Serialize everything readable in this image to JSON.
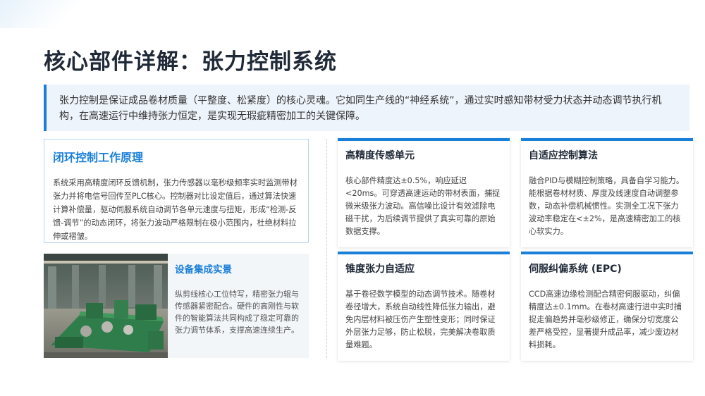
{
  "title": "核心部件详解：张力控制系统",
  "intro": "张力控制是保证成品卷材质量（平整度、松紧度）的核心灵魂。它如同生产线的“神经系统”，通过实时感知带材受力状态并动态调节执行机构，在高速运行中维持张力恒定，是实现无瑕疵精密加工的关键保障。",
  "principle": {
    "heading": "闭环控制工作原理",
    "body": "系统采用高精度闭环反馈机制，张力传感器以毫秒级频率实时监测带材张力并将电信号回传至PLC核心。控制器对比设定值后，通过算法快速计算补偿量，驱动伺服系统自动调节各单元速度与扭矩，形成“检测-反馈-调节”的动态闭环，将张力波动严格限制在极小范围内，杜绝材料拉伸或褶皱。"
  },
  "integration": {
    "heading": "设备集成实景",
    "body": "纵剪线核心工位特写，精密张力辊与传感器紧密配合。硬件的高刚性与软件的智能算法共同构成了稳定可靠的张力调节体系，支撑高速连续生产。"
  },
  "cards": [
    {
      "heading": "高精度传感单元",
      "body": "核心部件精度达±0.5%，响应延迟<20ms。可穿透高速运动的带材表面，捕捉微米级张力波动。高信噪比设计有效滤除电磁干扰，为后续调节提供了真实可靠的原始数据支撑。"
    },
    {
      "heading": "自适应控制算法",
      "body": "融合PID与模糊控制策略，具备自学习能力。能根据卷材材质、厚度及线速度自动调整参数，动态补偿机械惯性。实测全工况下张力波动率稳定在<±2%，是高速精密加工的核心软实力。"
    },
    {
      "heading": "锥度张力自适应",
      "body": "基于卷径数学模型的动态调节技术。随卷材卷径增大，系统自动线性降低张力输出，避免内层材料被压伤产生塑性变形；同时保证外层张力足够，防止松脱，完美解决卷取质量难题。"
    },
    {
      "heading": "伺服纠偏系统 (EPC)",
      "body": "CCD高速边缘检测配合精密伺服驱动，纠偏精度达±0.1mm。在卷材高速行进中实时捕捉走偏趋势并毫秒级修正，确保分切宽度公差严格受控，显著提升成品率，减少废边材料损耗。"
    }
  ],
  "colors": {
    "accent": "#1a7fd8",
    "intro_bg": "#eef4fb",
    "heading_dark": "#1f2937"
  },
  "icons": {
    "photo": "factory-slitting-line-photo"
  }
}
